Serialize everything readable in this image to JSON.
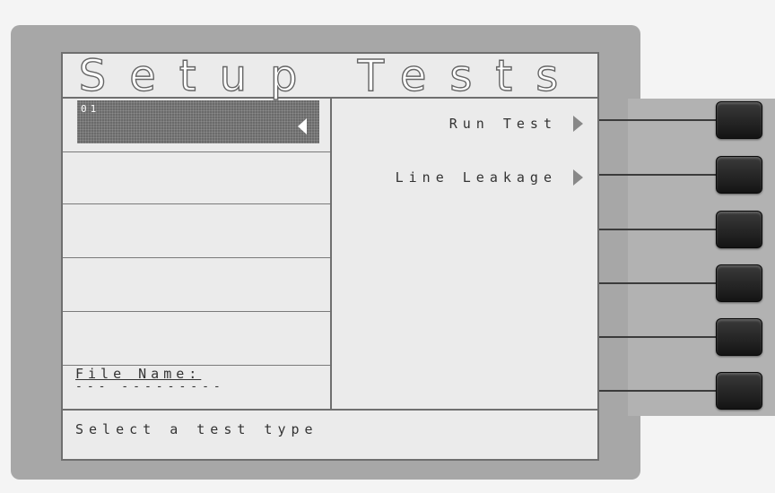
{
  "screen": {
    "title": "Setup Tests",
    "selected_slot": {
      "number": "01"
    },
    "file": {
      "label": "File Name:",
      "value": "--- ---------"
    },
    "menu": [
      {
        "label": "Run Test"
      },
      {
        "label": "Line Leakage"
      }
    ],
    "status": "Select a test type"
  },
  "icons": {
    "selection_arrow": "left-triangle-icon",
    "menu_arrow": "right-triangle-icon",
    "softkey": "hardware-button"
  }
}
